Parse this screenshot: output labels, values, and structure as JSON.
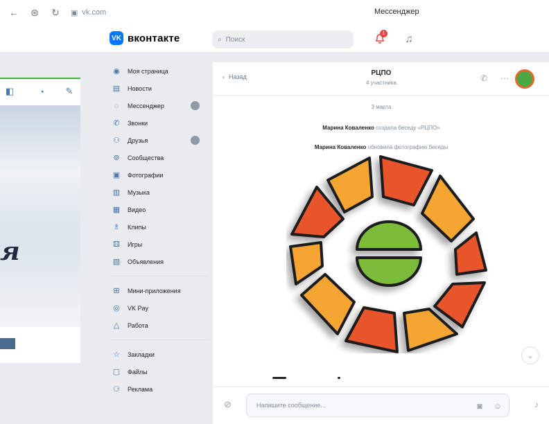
{
  "browser": {
    "back_icon": "arrow-left-icon",
    "url": "vk.com",
    "tab_title": "Мессенджер"
  },
  "header": {
    "logo_text": "вконтакте",
    "logo_mark": "VK",
    "search_placeholder": "Поиск",
    "notifications_count": "1"
  },
  "sidebar": {
    "items": [
      {
        "label": "Моя страница",
        "icon": "user-icon"
      },
      {
        "label": "Новости",
        "icon": "news-icon"
      },
      {
        "label": "Мессенджер",
        "icon": "message-icon"
      },
      {
        "label": "Звонки",
        "icon": "phone-icon"
      },
      {
        "label": "Друзья",
        "icon": "friends-icon"
      },
      {
        "label": "Сообщества",
        "icon": "groups-icon"
      },
      {
        "label": "Фотографии",
        "icon": "photo-icon"
      },
      {
        "label": "Музыка",
        "icon": "music-icon"
      },
      {
        "label": "Видео",
        "icon": "video-icon"
      },
      {
        "label": "Клипы",
        "icon": "clips-icon"
      },
      {
        "label": "Игры",
        "icon": "games-icon"
      },
      {
        "label": "Объявления",
        "icon": "ads-icon"
      }
    ],
    "items2": [
      {
        "label": "Мини-приложения",
        "icon": "apps-icon"
      },
      {
        "label": "VK Pay",
        "icon": "vkpay-icon"
      },
      {
        "label": "Работа",
        "icon": "work-icon"
      }
    ],
    "items3": [
      {
        "label": "Закладки",
        "icon": "bookmark-icon"
      },
      {
        "label": "Файлы",
        "icon": "file-icon"
      },
      {
        "label": "Реклама",
        "icon": "advert-icon"
      }
    ]
  },
  "chat": {
    "back_label": "Назад",
    "title": "РЦПО",
    "subtitle": "4 участника",
    "date": "3 марта",
    "system_messages": [
      {
        "author": "Марина Коваленко",
        "text": " создала беседу «РЦПО»"
      },
      {
        "author": "Марина Коваленко",
        "text": " обновила фотографию беседы"
      }
    ],
    "composer_placeholder": "Напишите сообщение..."
  },
  "colors": {
    "accent": "#0077ff",
    "emblem_dark_orange": "#e8552a",
    "emblem_light_orange": "#f5a531",
    "emblem_green": "#7dbb3a"
  }
}
